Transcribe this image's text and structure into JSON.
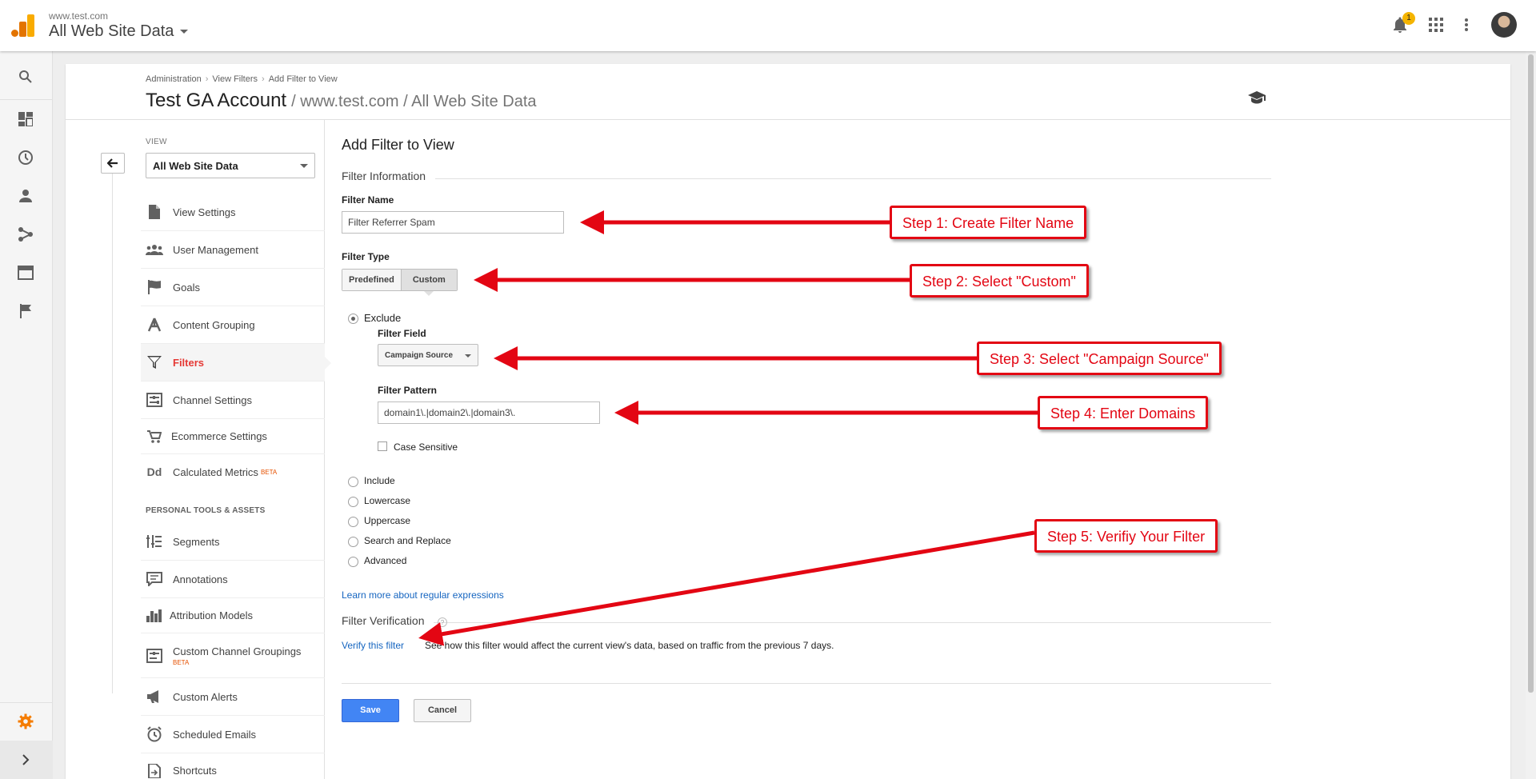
{
  "header": {
    "property_url": "www.test.com",
    "view_name": "All Web Site Data",
    "notification_count": "1",
    "icons": [
      "bell-icon",
      "apps-grid-icon",
      "more-vert-icon"
    ]
  },
  "rail": {
    "items": [
      "search-icon",
      "dashboard-icon",
      "realtime-icon",
      "audience-icon",
      "acquisition-icon",
      "behavior-icon",
      "conversions-icon"
    ],
    "admin_icon": "gear-icon",
    "expand_icon": "chevron-right-icon",
    "accent": "#f57c00"
  },
  "page": {
    "breadcrumbs": [
      "Administration",
      "View Filters",
      "Add Filter to View"
    ],
    "account_name": "Test GA Account",
    "account_path": "/ www.test.com / All Web Site Data"
  },
  "sidebar": {
    "view_label": "VIEW",
    "view_selected": "All Web Site Data",
    "items": [
      {
        "label": "View Settings",
        "icon": "document-icon"
      },
      {
        "label": "User Management",
        "icon": "users-icon"
      },
      {
        "label": "Goals",
        "icon": "flag-icon"
      },
      {
        "label": "Content Grouping",
        "icon": "content-grouping-icon"
      },
      {
        "label": "Filters",
        "icon": "filter-icon",
        "active": true
      },
      {
        "label": "Channel Settings",
        "icon": "channel-settings-icon"
      },
      {
        "label": "Ecommerce Settings",
        "icon": "cart-icon"
      },
      {
        "label": "Calculated Metrics",
        "icon": "dd-icon",
        "badge": "BETA"
      }
    ],
    "personal_heading": "PERSONAL TOOLS & ASSETS",
    "personal_items": [
      {
        "label": "Segments",
        "icon": "segments-icon"
      },
      {
        "label": "Annotations",
        "icon": "annotation-icon"
      },
      {
        "label": "Attribution Models",
        "icon": "bar-chart-icon"
      },
      {
        "label": "Custom Channel Groupings",
        "icon": "channel-grouping-icon",
        "badge": "BETA"
      },
      {
        "label": "Custom Alerts",
        "icon": "megaphone-icon"
      },
      {
        "label": "Scheduled Emails",
        "icon": "clock-icon"
      },
      {
        "label": "Shortcuts",
        "icon": "shortcut-icon"
      }
    ],
    "active_color": "#e53935"
  },
  "form": {
    "title": "Add Filter to View",
    "info_section": "Filter Information",
    "name_label": "Filter Name",
    "name_value": "Filter Referrer Spam",
    "type_label": "Filter Type",
    "type_predefined": "Predefined",
    "type_custom": "Custom",
    "exclude_label": "Exclude",
    "field_label": "Filter Field",
    "field_value": "Campaign Source",
    "pattern_label": "Filter Pattern",
    "pattern_value": "domain1\\.|domain2\\.|domain3\\.",
    "case_sensitive": "Case Sensitive",
    "options": [
      "Include",
      "Lowercase",
      "Uppercase",
      "Search and Replace",
      "Advanced"
    ],
    "regex_link": "Learn more about regular expressions",
    "verify_section": "Filter Verification",
    "verify_link": "Verify this filter",
    "verify_desc": "See how this filter would affect the current view's data, based on traffic from the previous 7 days.",
    "save": "Save",
    "cancel": "Cancel"
  },
  "annotations": {
    "step1": "Step 1: Create Filter Name",
    "step2": "Step 2: Select \"Custom\"",
    "step3": "Step 3: Select \"Campaign Source\"",
    "step4": "Step 4: Enter Domains",
    "step5": "Step 5: Verifiy Your Filter",
    "color": "#e30613"
  }
}
